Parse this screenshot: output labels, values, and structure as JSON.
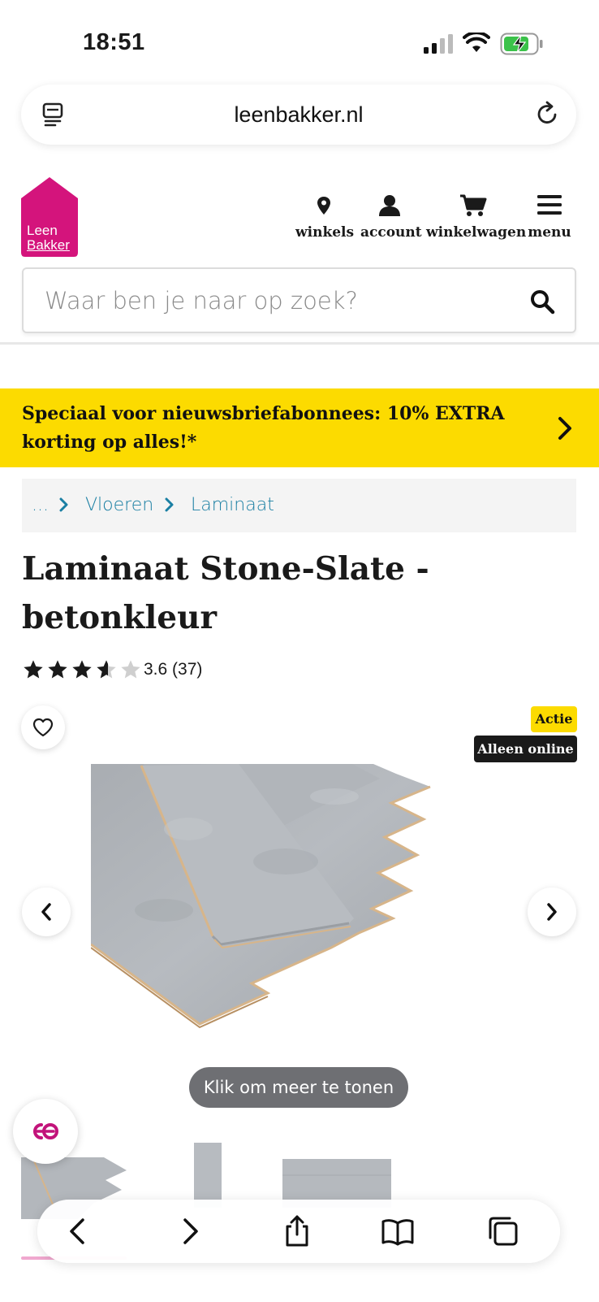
{
  "status_bar": {
    "time": "18:51"
  },
  "browser": {
    "url": "leenbakker.nl"
  },
  "header": {
    "logo_line1": "Leen",
    "logo_line2": "Bakker",
    "nav": [
      {
        "label": "winkels",
        "icon": "location-pin-icon"
      },
      {
        "label": "account",
        "icon": "user-icon"
      },
      {
        "label": "winkelwagen",
        "icon": "cart-icon"
      },
      {
        "label": "menu",
        "icon": "hamburger-icon"
      }
    ]
  },
  "search": {
    "placeholder": "Waar ben je naar op zoek?"
  },
  "promo": {
    "text": "Speciaal voor nieuwsbriefabonnees: 10% EXTRA korting op alles!*"
  },
  "breadcrumb": {
    "items": [
      "...",
      "Vloeren",
      "Laminaat"
    ]
  },
  "product": {
    "title": "Laminaat Stone-Slate - betonkleur",
    "rating_value": 3.6,
    "rating_text": "3.6 (37)",
    "badges": {
      "actie": "Actie",
      "online": "Alleen online"
    },
    "more_button": "Klik om meer te tonen"
  },
  "colors": {
    "brand": "#d4147c",
    "promo": "#fcdb00",
    "link": "#1a7fa3",
    "text": "#1a1a1a"
  }
}
